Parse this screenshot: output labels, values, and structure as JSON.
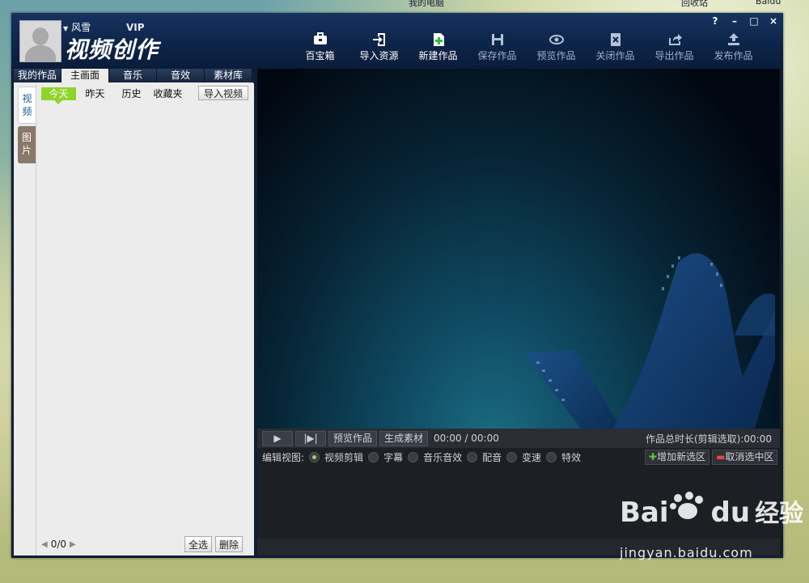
{
  "desktop": {
    "top_texts": [
      "我的电脑",
      "回收站",
      "Baidu"
    ]
  },
  "app": {
    "title": "视频创作",
    "username": "风雪",
    "vip_label": "VIP",
    "window_buttons": [
      "?",
      "–",
      "□",
      "×"
    ]
  },
  "toolbar": [
    {
      "label": "百宝箱",
      "icon": "toolbox-icon",
      "enabled": true
    },
    {
      "label": "导入资源",
      "icon": "import-icon",
      "enabled": true
    },
    {
      "label": "新建作品",
      "icon": "new-project-icon",
      "enabled": true
    },
    {
      "label": "保存作品",
      "icon": "save-icon",
      "enabled": false
    },
    {
      "label": "预览作品",
      "icon": "eye-icon",
      "enabled": false
    },
    {
      "label": "关闭作品",
      "icon": "close-file-icon",
      "enabled": false
    },
    {
      "label": "导出作品",
      "icon": "export-icon",
      "enabled": false
    },
    {
      "label": "发布作品",
      "icon": "upload-icon",
      "enabled": false
    }
  ],
  "left_panel": {
    "tabs": [
      "我的作品",
      "主画面",
      "音乐",
      "音效",
      "素材库"
    ],
    "active_tab": "主画面",
    "side_tabs": [
      "视频",
      "图片"
    ],
    "date_tabs": [
      "今天",
      "昨天",
      "历史",
      "收藏夹"
    ],
    "import_button": "导入视频",
    "pager": "0/0",
    "select_all": "全选",
    "delete": "删除"
  },
  "editor": {
    "preview_button": "预览作品",
    "generate_button": "生成素材",
    "time": "00:00 / 00:00",
    "total_label": "作品总时长(剪辑选取):00:00",
    "view_label": "编辑视图:",
    "views": [
      {
        "label": "视频剪辑",
        "selected": true
      },
      {
        "label": "字幕",
        "selected": false
      },
      {
        "label": "音乐音效",
        "selected": false
      },
      {
        "label": "配音",
        "selected": false
      },
      {
        "label": "变速",
        "selected": false
      },
      {
        "label": "特效",
        "selected": false
      }
    ],
    "add_zone": "增加新选区",
    "cancel_zone": "取消选中区"
  },
  "watermark": {
    "brand": "Bai",
    "brand_suffix": "du",
    "cn": "经验",
    "url": "jingyan.baidu.com"
  },
  "colors": {
    "accent_green": "#8ed42a",
    "titlebar": "#0d2448"
  }
}
